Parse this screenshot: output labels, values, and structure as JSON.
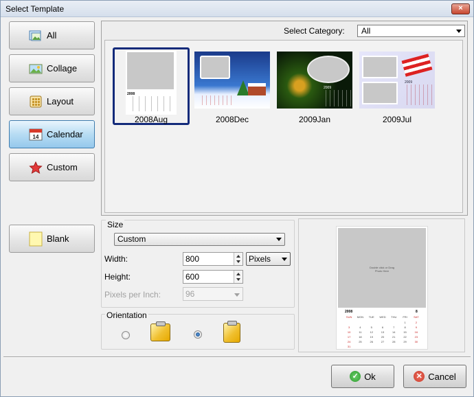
{
  "window": {
    "title": "Select Template",
    "close_glyph": "×"
  },
  "sidebar": {
    "items": [
      {
        "label": "All",
        "icon": "picture-icon"
      },
      {
        "label": "Collage",
        "icon": "photo-landscape-icon"
      },
      {
        "label": "Layout",
        "icon": "grid-layout-icon"
      },
      {
        "label": "Calendar",
        "icon": "calendar-icon",
        "calendar_day": "14",
        "selected": true
      },
      {
        "label": "Custom",
        "icon": "star-icon"
      }
    ],
    "blank": {
      "label": "Blank",
      "icon": "blank-page-icon"
    }
  },
  "category": {
    "label": "Select Category:",
    "value": "All"
  },
  "templates": [
    {
      "name": "2008Aug",
      "selected": true
    },
    {
      "name": "2008Dec",
      "selected": false
    },
    {
      "name": "2009Jan",
      "selected": false
    },
    {
      "name": "2009Jul",
      "selected": false
    }
  ],
  "thumb_text": {
    "year_2008": "2008",
    "year_2009": "2009"
  },
  "size": {
    "group_label": "Size",
    "preset": "Custom",
    "width_label": "Width:",
    "width_value": "800",
    "height_label": "Height:",
    "height_value": "600",
    "unit": "Pixels",
    "ppi_label": "Pixels per Inch:",
    "ppi_value": "96"
  },
  "orientation": {
    "label": "Orientation",
    "selected": "landscape"
  },
  "preview": {
    "photo_hint": "Double click or Drag Photo Here",
    "year": "2008",
    "month_number": "8",
    "weekdays": [
      "SUN",
      "MON",
      "TUE",
      "WED",
      "THU",
      "FRI",
      "SAT"
    ],
    "days": [
      "",
      "",
      "",
      "",
      "",
      "1",
      "2",
      "3",
      "4",
      "5",
      "6",
      "7",
      "8",
      "9",
      "10",
      "11",
      "12",
      "13",
      "14",
      "15",
      "16",
      "17",
      "18",
      "19",
      "20",
      "21",
      "22",
      "23",
      "24",
      "25",
      "26",
      "27",
      "28",
      "29",
      "30",
      "31"
    ]
  },
  "buttons": {
    "ok": "Ok",
    "cancel": "Cancel"
  },
  "colors": {
    "accent": "#132a7a",
    "selected_button": "#95c8ec",
    "ok_green": "#2f9a2f",
    "cancel_red": "#c83a2a"
  }
}
